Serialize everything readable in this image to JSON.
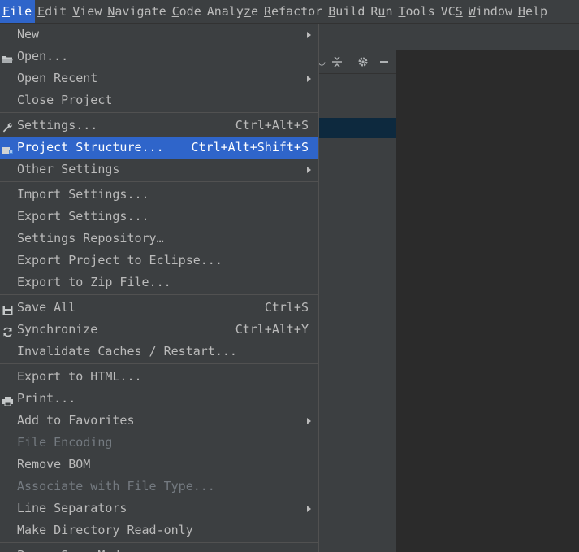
{
  "menubar": {
    "items": [
      {
        "pre": "",
        "mn": "F",
        "post": "ile",
        "active": true
      },
      {
        "pre": "",
        "mn": "E",
        "post": "dit",
        "active": false
      },
      {
        "pre": "",
        "mn": "V",
        "post": "iew",
        "active": false
      },
      {
        "pre": "",
        "mn": "N",
        "post": "avigate",
        "active": false
      },
      {
        "pre": "",
        "mn": "C",
        "post": "ode",
        "active": false
      },
      {
        "pre": "Analy",
        "mn": "z",
        "post": "e",
        "active": false
      },
      {
        "pre": "",
        "mn": "R",
        "post": "efactor",
        "active": false
      },
      {
        "pre": "",
        "mn": "B",
        "post": "uild",
        "active": false
      },
      {
        "pre": "R",
        "mn": "u",
        "post": "n",
        "active": false
      },
      {
        "pre": "",
        "mn": "T",
        "post": "ools",
        "active": false
      },
      {
        "pre": "VC",
        "mn": "S",
        "post": "",
        "active": false
      },
      {
        "pre": "",
        "mn": "W",
        "post": "indow",
        "active": false
      },
      {
        "pre": "",
        "mn": "H",
        "post": "elp",
        "active": false
      }
    ]
  },
  "file_menu": {
    "groups": [
      [
        {
          "label": "New",
          "submenu": true
        },
        {
          "label": "Open...",
          "icon": "folder-icon"
        },
        {
          "label": "Open Recent",
          "submenu": true
        },
        {
          "label": "Close Project"
        }
      ],
      [
        {
          "label": "Settings...",
          "shortcut": "Ctrl+Alt+S",
          "icon": "wrench-icon"
        },
        {
          "label": "Project Structure...",
          "shortcut": "Ctrl+Alt+Shift+S",
          "icon": "project-structure-icon",
          "selected": true
        },
        {
          "label": "Other Settings",
          "submenu": true
        }
      ],
      [
        {
          "label": "Import Settings..."
        },
        {
          "label": "Export Settings..."
        },
        {
          "label": "Settings Repository…"
        },
        {
          "label": "Export Project to Eclipse..."
        },
        {
          "label": "Export to Zip File..."
        }
      ],
      [
        {
          "label": "Save All",
          "shortcut": "Ctrl+S",
          "icon": "save-icon"
        },
        {
          "label": "Synchronize",
          "shortcut": "Ctrl+Alt+Y",
          "icon": "sync-icon"
        },
        {
          "label": "Invalidate Caches / Restart..."
        }
      ],
      [
        {
          "label": "Export to HTML..."
        },
        {
          "label": "Print...",
          "icon": "printer-icon"
        },
        {
          "label": "Add to Favorites",
          "submenu": true
        },
        {
          "label": "File Encoding",
          "disabled": true
        },
        {
          "label": "Remove BOM"
        },
        {
          "label": "Associate with File Type...",
          "disabled": true
        },
        {
          "label": "Line Separators",
          "submenu": true
        },
        {
          "label": "Make Directory Read-only"
        }
      ],
      [
        {
          "label": "Power Save Mode"
        }
      ]
    ]
  },
  "colors": {
    "accent": "#2f65ca",
    "menu_bg": "#3c3f41",
    "editor_bg": "#2b2b2b",
    "text": "#bbbbbb",
    "disabled_text": "#747a80"
  }
}
